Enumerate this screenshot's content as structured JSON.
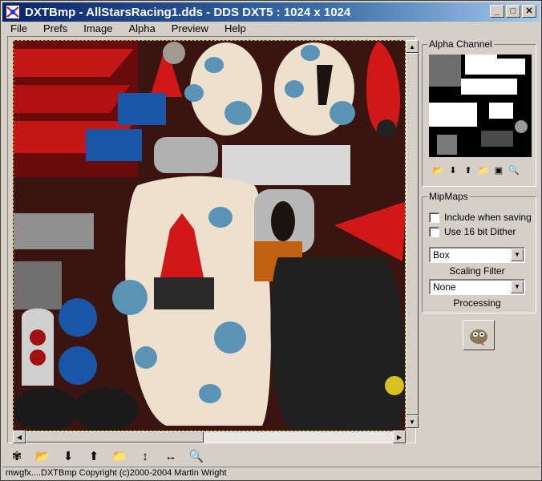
{
  "window": {
    "title": "DXTBmp - AllStarsRacing1.dds - DDS DXT5 : 1024 x 1024",
    "minimize": "_",
    "maximize": "□",
    "close": "✕"
  },
  "menu": [
    "File",
    "Prefs",
    "Image",
    "Alpha",
    "Preview",
    "Help"
  ],
  "alpha_channel": {
    "label": "Alpha Channel",
    "tools": [
      "open-folder-icon",
      "import-icon",
      "export-icon",
      "folder-up-icon",
      "image-icon",
      "magnifier-icon"
    ]
  },
  "mipmaps": {
    "label": "MipMaps",
    "include_when_saving": {
      "label": "Include when saving",
      "checked": false
    },
    "use_16_bit_dither": {
      "label": "Use 16 bit Dither",
      "checked": false
    },
    "scaling_filter": {
      "value": "Box",
      "caption": "Scaling Filter"
    },
    "processing": {
      "value": "None",
      "caption": "Processing"
    }
  },
  "bottom_tools": [
    "butterfly-icon",
    "open-folder-icon",
    "import-icon",
    "export-icon",
    "folder-up-icon",
    "vertical-arrows-icon",
    "horizontal-arrows-icon",
    "magnifier-icon"
  ],
  "status": "mwgfx....DXTBmp Copyright (c)2000-2004 Martin Wright",
  "colors": {
    "title_start": "#0a246a",
    "title_end": "#a6caf0",
    "face": "#d4d0c8"
  }
}
